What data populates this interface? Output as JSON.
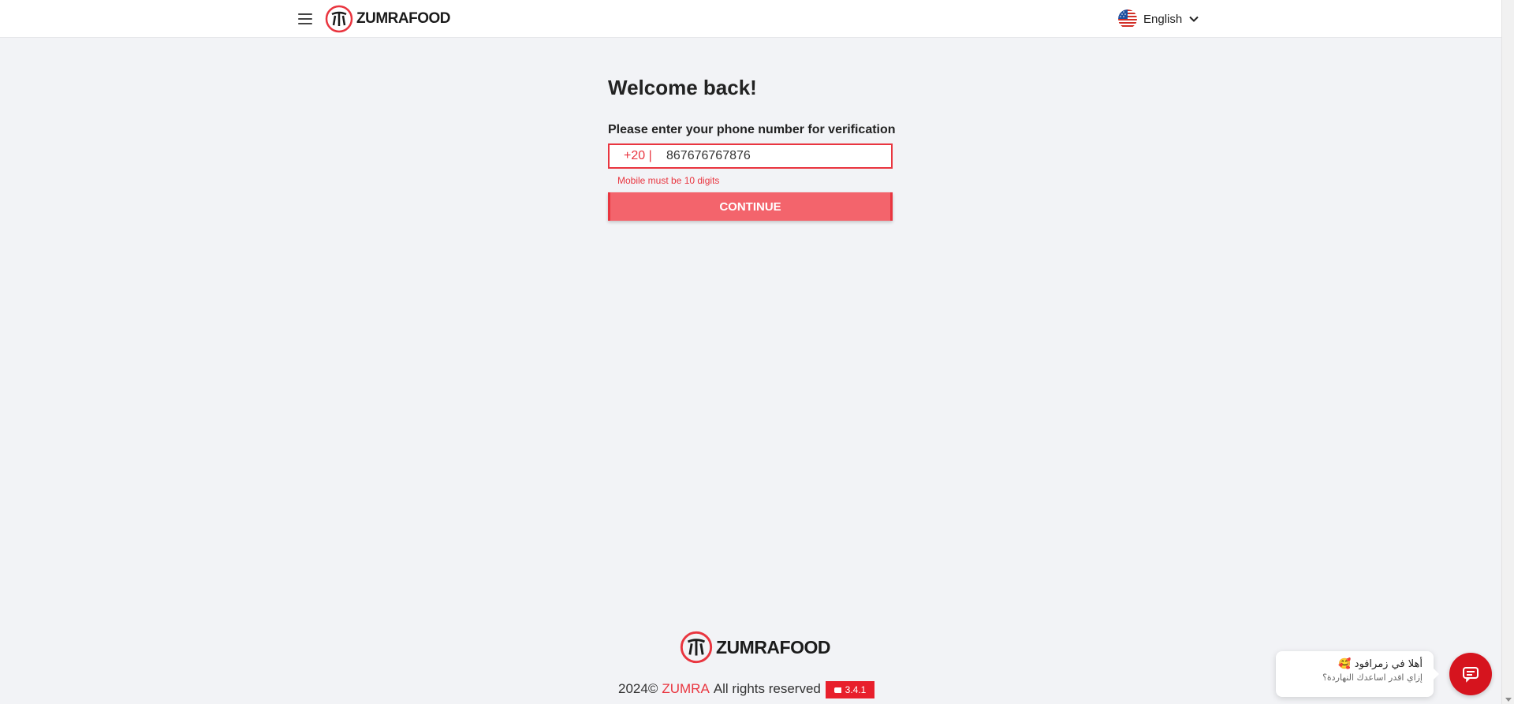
{
  "header": {
    "brand": "ZUMRAFOOD",
    "language": "English",
    "menu_icon": "hamburger-menu-icon",
    "flag_icon": "us-flag-icon",
    "chevron_icon": "chevron-down-icon"
  },
  "login": {
    "title": "Welcome back!",
    "prompt": "Please enter your phone number for verification",
    "country_code": "+20 |",
    "phone_value": "867676767876",
    "error": "Mobile must be 10 digits",
    "continue_label": "CONTINUE"
  },
  "footer": {
    "brand": "ZUMRAFOOD",
    "copyright_year": "2024©",
    "company": "ZUMRA",
    "rights": "All rights reserved",
    "version": "3.4.1"
  },
  "chat": {
    "greeting": "أهلا في زمرافود 🥰",
    "subtitle": "إزاي اقدر اساعدك النهاردة؟",
    "chat_icon": "chat-icon"
  },
  "colors": {
    "accent": "#e9353f",
    "button": "#f3646c",
    "chat": "#d6141e",
    "background": "#f2f3f6"
  }
}
